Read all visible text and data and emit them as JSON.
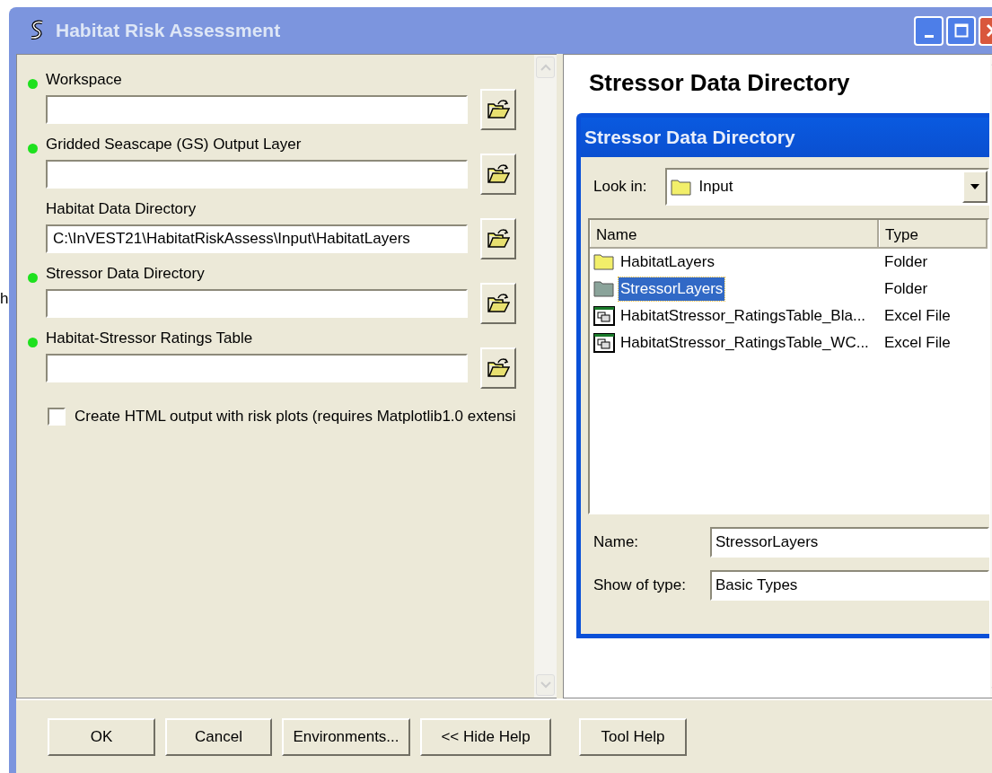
{
  "background_text": "h",
  "window": {
    "title": "Habitat Risk Assessment"
  },
  "parameters": [
    {
      "label": "Workspace",
      "required": true
    },
    {
      "label": "Gridded Seascape (GS) Output Layer",
      "required": true
    },
    {
      "label": "Habitat Data Directory",
      "required": false,
      "value": "C:\\InVEST21\\HabitatRiskAssess\\Input\\HabitatLayers"
    },
    {
      "label": "Stressor Data Directory",
      "required": true
    },
    {
      "label": "Habitat-Stressor Ratings Table",
      "required": true
    }
  ],
  "option": {
    "label": "Create HTML output with risk plots (requires Matplotlib1.0 extensi",
    "checked": false
  },
  "help": {
    "heading": "Stressor Data Directory",
    "dialog": {
      "title": "Stressor Data Directory",
      "look_in_label": "Look in:",
      "look_in": "Input",
      "columns": [
        "Name",
        "Type"
      ],
      "files": [
        {
          "kind": "folder",
          "name": "HabitatLayers",
          "type": "Folder",
          "selected": false
        },
        {
          "kind": "folder",
          "name": "StressorLayers",
          "type": "Folder",
          "selected": true
        },
        {
          "kind": "excel",
          "name": "HabitatStressor_RatingsTable_Bla...",
          "type": "Excel File",
          "selected": false
        },
        {
          "kind": "excel",
          "name": "HabitatStressor_RatingsTable_WC...",
          "type": "Excel File",
          "selected": false
        }
      ],
      "name_label": "Name:",
      "name_value": "StressorLayers",
      "type_label": "Show of type:",
      "type_value": "Basic Types"
    }
  },
  "buttons": [
    "OK",
    "Cancel",
    "Environments...",
    "<< Hide Help"
  ],
  "help_button": "Tool Help"
}
